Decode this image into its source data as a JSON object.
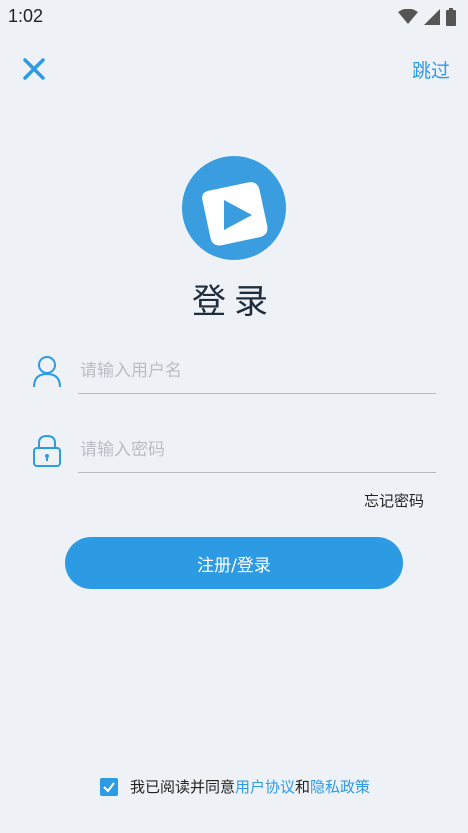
{
  "status_bar": {
    "time": "1:02"
  },
  "header": {
    "skip_label": "跳过"
  },
  "title": "登录",
  "username": {
    "placeholder": "请输入用户名"
  },
  "password": {
    "placeholder": "请输入密码"
  },
  "forgot_label": "忘记密码",
  "submit_label": "注册/登录",
  "agreement": {
    "prefix": "我已阅读并同意",
    "user_agreement": "用户协议",
    "conjunction": "和",
    "privacy_policy": "隐私政策",
    "checked": true
  },
  "colors": {
    "accent": "#2d9be3",
    "background": "#eef2f6"
  },
  "icons": [
    "wifi-icon",
    "signal-icon",
    "battery-icon",
    "close-icon",
    "app-logo-icon",
    "user-icon",
    "lock-icon",
    "checkmark-icon"
  ]
}
